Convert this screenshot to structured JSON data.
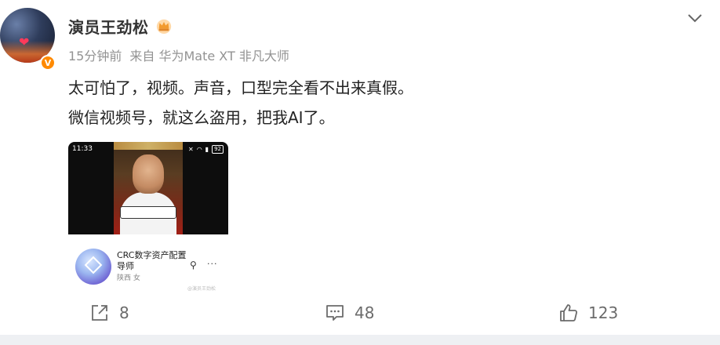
{
  "post": {
    "username": "演员王劲松",
    "meta": {
      "time": "15分钟前",
      "source": "来自 华为Mate XT 非凡大师"
    },
    "content_lines": [
      "太可怕了，视频。声音，口型完全看不出来真假。",
      "微信视频号，就这么盗用，把我AI了。"
    ],
    "icons": {
      "avatar_badge": "verified-v-icon",
      "name_badge": "crown-icon",
      "more": "chevron-down-icon"
    }
  },
  "media": {
    "phone_time": "11:33",
    "battery": "92",
    "channel_name": "CRC数字资产配置导师",
    "channel_location": "陕西 女"
  },
  "actions": {
    "repost_count": "8",
    "comment_count": "48",
    "like_count": "123"
  },
  "colors": {
    "accent": "#ff8a00",
    "meta_gray": "#939393",
    "icon_gray": "#6b6b6b"
  }
}
